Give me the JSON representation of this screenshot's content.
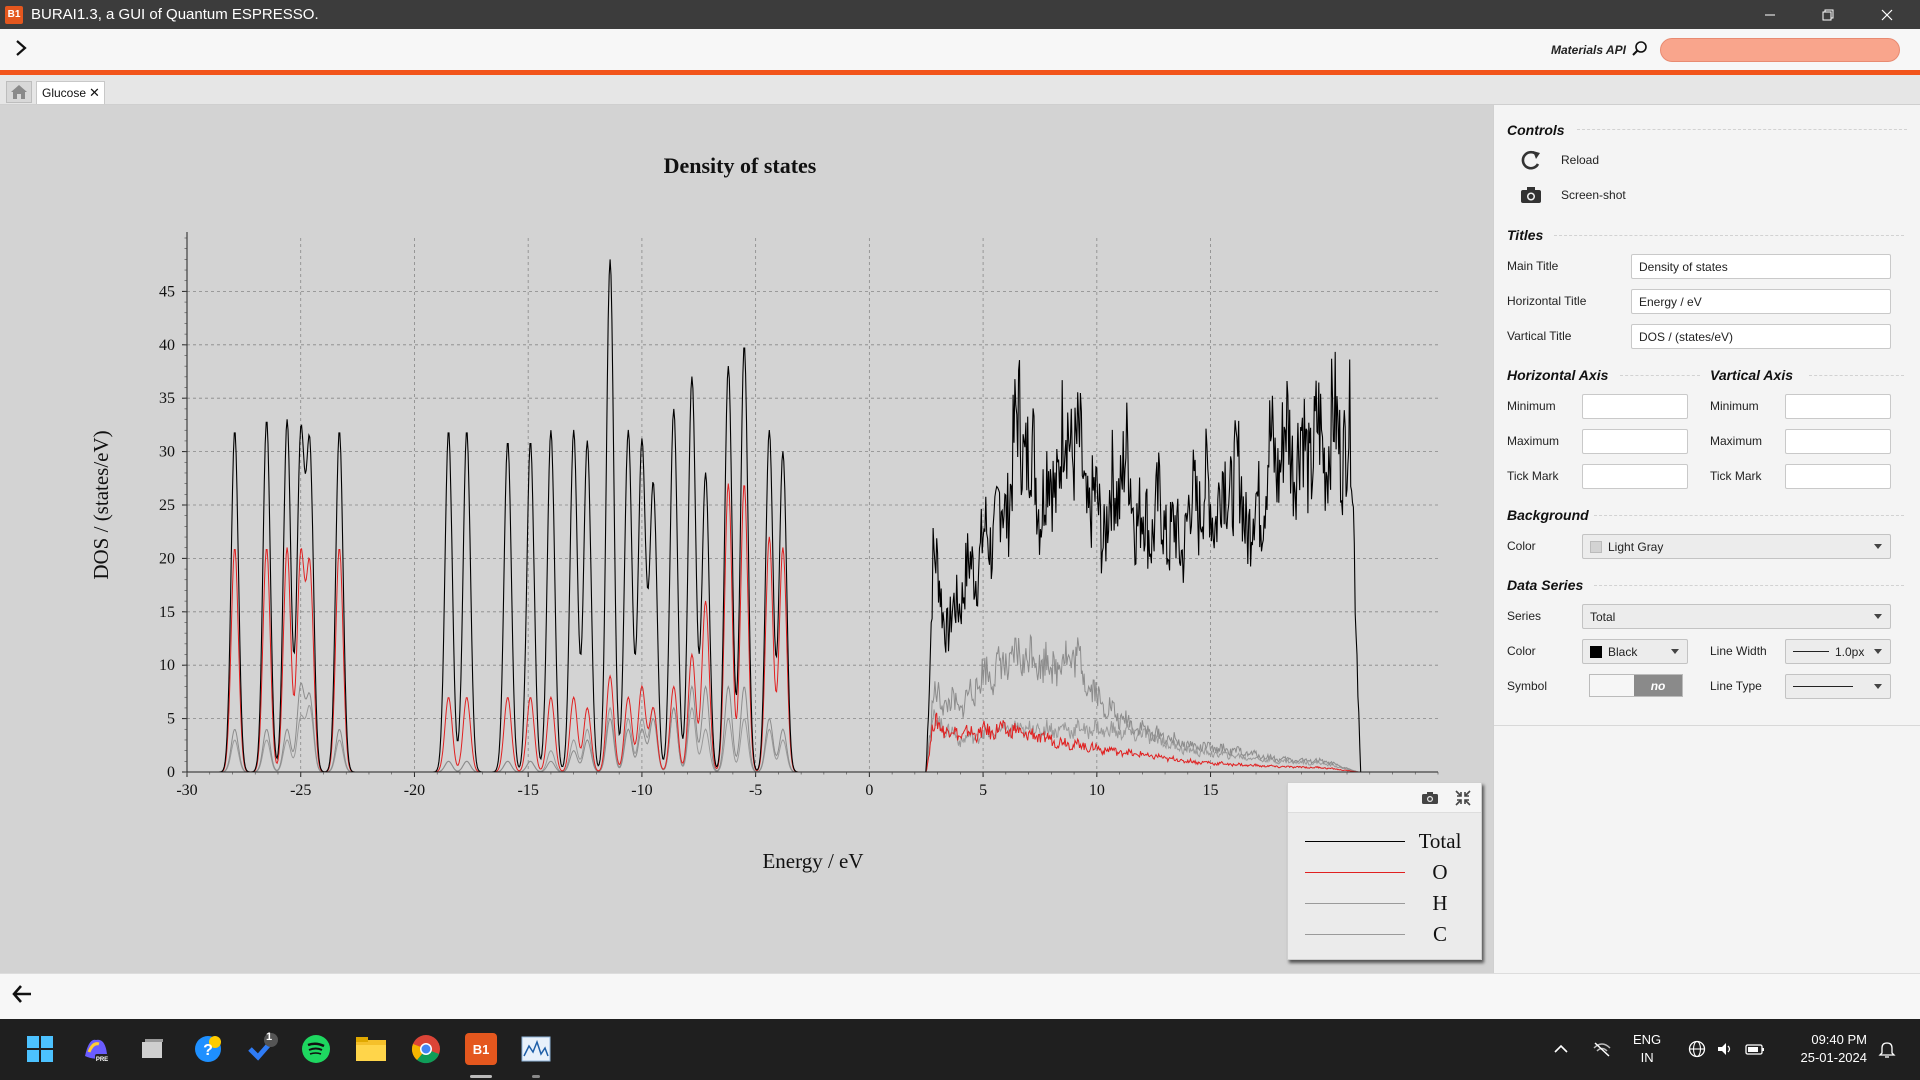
{
  "window": {
    "title": "BURAI1.3, a GUI of Quantum ESPRESSO.",
    "icon_text": "B1"
  },
  "toolbar": {
    "materials_label": "Materials API",
    "search_value": ""
  },
  "tabs": [
    {
      "label": "Glucose",
      "close": "✕"
    }
  ],
  "plot": {
    "background": "#d3d3d3",
    "colors": {
      "total": "#000000",
      "O": "#e02020",
      "H": "#8c8c8c",
      "C": "#9a9a9a"
    }
  },
  "chart_data": {
    "type": "line",
    "title": "Density of states",
    "xlabel": "Energy / eV",
    "ylabel": "DOS / (states/eV)",
    "xlim": [
      -30,
      25
    ],
    "ylim": [
      0,
      50
    ],
    "x_ticks": [
      -30,
      -25,
      -20,
      -15,
      -10,
      -5,
      0,
      5,
      10,
      15
    ],
    "y_ticks": [
      0,
      5,
      10,
      15,
      20,
      25,
      30,
      35,
      40,
      45
    ],
    "grid": true,
    "legend_position": "bottom-right",
    "series": [
      {
        "name": "Total",
        "color": "#000000",
        "peaks": [
          [
            -27.9,
            32
          ],
          [
            -26.5,
            33
          ],
          [
            -25.6,
            33
          ],
          [
            -25.0,
            31
          ],
          [
            -24.6,
            30
          ],
          [
            -23.3,
            32
          ],
          [
            -18.5,
            32
          ],
          [
            -17.7,
            32
          ],
          [
            -15.9,
            31
          ],
          [
            -14.9,
            31
          ],
          [
            -14.0,
            32
          ],
          [
            -13.0,
            32
          ],
          [
            -12.4,
            31
          ],
          [
            -11.4,
            48
          ],
          [
            -10.6,
            32
          ],
          [
            -10.0,
            31
          ],
          [
            -9.5,
            27
          ],
          [
            -8.6,
            34
          ],
          [
            -7.8,
            37
          ],
          [
            -7.2,
            28
          ],
          [
            -6.2,
            38
          ],
          [
            -5.5,
            40
          ],
          [
            -4.4,
            32
          ],
          [
            -3.8,
            30
          ]
        ],
        "band": [
          [
            2.5,
            0
          ],
          [
            2.8,
            20
          ],
          [
            3.5,
            13
          ],
          [
            4,
            17
          ],
          [
            5,
            21
          ],
          [
            6,
            25
          ],
          [
            6.6,
            33
          ],
          [
            7.5,
            26
          ],
          [
            8.2,
            28
          ],
          [
            8.8,
            33
          ],
          [
            9.5,
            26
          ],
          [
            10.3,
            23
          ],
          [
            11.2,
            29
          ],
          [
            12,
            23
          ],
          [
            12.8,
            24
          ],
          [
            13.6,
            21
          ],
          [
            14.4,
            26
          ],
          [
            15.2,
            25
          ],
          [
            16,
            28
          ],
          [
            16.8,
            23
          ],
          [
            17.6,
            29
          ],
          [
            18.4,
            31
          ],
          [
            19.2,
            30
          ],
          [
            20,
            31
          ],
          [
            20.7,
            32
          ],
          [
            21.2,
            30
          ],
          [
            21.6,
            0
          ]
        ]
      },
      {
        "name": "O",
        "color": "#e02020",
        "peaks": [
          [
            -27.9,
            21
          ],
          [
            -26.5,
            21
          ],
          [
            -25.6,
            21
          ],
          [
            -25.0,
            20
          ],
          [
            -24.6,
            19
          ],
          [
            -23.3,
            21
          ],
          [
            -18.5,
            7
          ],
          [
            -17.7,
            7
          ],
          [
            -15.9,
            7
          ],
          [
            -14.9,
            7
          ],
          [
            -14.0,
            7
          ],
          [
            -13.0,
            7
          ],
          [
            -12.4,
            6
          ],
          [
            -11.4,
            9
          ],
          [
            -10.6,
            7
          ],
          [
            -10.0,
            8
          ],
          [
            -9.5,
            6
          ],
          [
            -8.6,
            8
          ],
          [
            -7.8,
            11
          ],
          [
            -7.2,
            16
          ],
          [
            -6.2,
            27
          ],
          [
            -5.5,
            27
          ],
          [
            -4.4,
            22
          ],
          [
            -3.8,
            21
          ]
        ],
        "band": [
          [
            2.5,
            0
          ],
          [
            2.8,
            4.5
          ],
          [
            4,
            3.5
          ],
          [
            6,
            4
          ],
          [
            8,
            3
          ],
          [
            10,
            2.2
          ],
          [
            12,
            1.6
          ],
          [
            14,
            1
          ],
          [
            16,
            0.7
          ],
          [
            18,
            0.5
          ],
          [
            20,
            0.4
          ],
          [
            21.5,
            0
          ]
        ]
      },
      {
        "name": "H",
        "color": "#8c8c8c",
        "peaks": [
          [
            -27.9,
            4
          ],
          [
            -26.5,
            4
          ],
          [
            -25.6,
            4
          ],
          [
            -25.0,
            8
          ],
          [
            -24.6,
            7
          ],
          [
            -23.3,
            4
          ],
          [
            -18.5,
            1
          ],
          [
            -17.7,
            1
          ],
          [
            -15.9,
            1
          ],
          [
            -14.9,
            1
          ],
          [
            -14.0,
            1
          ],
          [
            -13.0,
            2
          ],
          [
            -12.4,
            3
          ],
          [
            -11.4,
            5
          ],
          [
            -10.6,
            4
          ],
          [
            -10.0,
            4
          ],
          [
            -9.5,
            5
          ],
          [
            -8.6,
            6
          ],
          [
            -7.8,
            8
          ],
          [
            -7.2,
            8
          ],
          [
            -6.2,
            8
          ],
          [
            -5.5,
            8
          ],
          [
            -4.4,
            5
          ],
          [
            -3.8,
            4
          ]
        ],
        "band": [
          [
            2.5,
            0
          ],
          [
            2.8,
            7
          ],
          [
            4,
            6
          ],
          [
            5,
            9
          ],
          [
            6,
            10
          ],
          [
            7,
            11
          ],
          [
            8,
            10
          ],
          [
            9,
            11
          ],
          [
            10,
            7
          ],
          [
            11,
            5
          ],
          [
            12,
            4
          ],
          [
            14,
            2.5
          ],
          [
            16,
            2
          ],
          [
            18,
            1.2
          ],
          [
            20,
            1
          ],
          [
            21.5,
            0
          ]
        ]
      },
      {
        "name": "C",
        "color": "#9a9a9a",
        "peaks": [
          [
            -27.9,
            3
          ],
          [
            -26.5,
            3
          ],
          [
            -25.6,
            3
          ],
          [
            -25.0,
            5
          ],
          [
            -24.6,
            6
          ],
          [
            -23.3,
            3
          ],
          [
            -18.5,
            1
          ],
          [
            -17.7,
            1
          ],
          [
            -15.9,
            1
          ],
          [
            -14.9,
            1
          ],
          [
            -14.0,
            2
          ],
          [
            -13.0,
            3
          ],
          [
            -12.4,
            4
          ],
          [
            -11.4,
            6
          ],
          [
            -10.6,
            5
          ],
          [
            -10.0,
            5
          ],
          [
            -9.5,
            6
          ],
          [
            -8.6,
            6
          ],
          [
            -7.8,
            6
          ],
          [
            -7.2,
            4
          ],
          [
            -6.2,
            5
          ],
          [
            -5.5,
            5
          ],
          [
            -4.4,
            4
          ],
          [
            -3.8,
            3
          ]
        ],
        "band": [
          [
            2.5,
            0
          ],
          [
            2.8,
            5
          ],
          [
            4,
            3
          ],
          [
            6,
            4
          ],
          [
            8,
            4
          ],
          [
            10,
            4
          ],
          [
            12,
            3.5
          ],
          [
            14,
            2
          ],
          [
            16,
            1.5
          ],
          [
            18,
            1
          ],
          [
            20,
            0.8
          ],
          [
            21.5,
            0
          ]
        ]
      }
    ]
  },
  "legend": {
    "items": [
      "Total",
      "O",
      "H",
      "C"
    ]
  },
  "panel": {
    "controls": {
      "title": "Controls",
      "reload": "Reload",
      "screenshot": "Screen-shot"
    },
    "titles": {
      "title": "Titles",
      "main_label": "Main Title",
      "main_value": "Density of states",
      "horizontal_label": "Horizontal Title",
      "horizontal_value": "Energy / eV",
      "vertical_label": "Vartical Title",
      "vertical_value": "DOS / (states/eV)"
    },
    "haxis": {
      "title": "Horizontal Axis",
      "min_label": "Minimum",
      "max_label": "Maximum",
      "tick_label": "Tick Mark"
    },
    "vaxis": {
      "title": "Vartical Axis",
      "min_label": "Minimum",
      "max_label": "Maximum",
      "tick_label": "Tick Mark"
    },
    "background": {
      "title": "Background",
      "color_label": "Color",
      "color_value": "Light Gray"
    },
    "series": {
      "title": "Data Series",
      "series_label": "Series",
      "series_value": "Total",
      "color_label": "Color",
      "color_value": "Black",
      "width_label": "Line Width",
      "width_value": "1.0px",
      "symbol_label": "Symbol",
      "symbol_value": "no",
      "type_label": "Line Type"
    }
  },
  "taskbar": {
    "lang": "ENG",
    "region": "IN",
    "time": "09:40 PM",
    "date": "25-01-2024",
    "todo_badge": "1",
    "b1_label": "B1"
  }
}
